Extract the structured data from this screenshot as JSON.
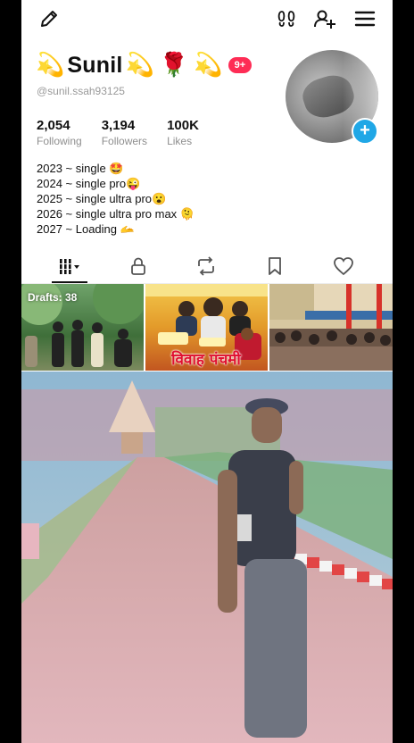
{
  "profile": {
    "name": "Sunil",
    "name_emoji_left": "💫",
    "name_emoji_mid1": "💫",
    "name_emoji_rose": "🌹",
    "name_emoji_mid2": "💫",
    "notification_badge": "9+",
    "handle": "@sunil.ssah93125"
  },
  "stats": [
    {
      "value": "2,054",
      "label": "Following"
    },
    {
      "value": "3,194",
      "label": "Followers"
    },
    {
      "value": "100K",
      "label": "Likes"
    }
  ],
  "bio": [
    "2023 ~ single 🤩",
    "2024 ~ single pro😜",
    "2025 ~ single ultra pro😮",
    "2026 ~ single ultra pro max 🫠",
    "2027 ~ Loading 🫴"
  ],
  "tabs": {
    "active": "videos",
    "items": [
      "videos-grid-icon",
      "lock-icon",
      "repost-icon",
      "bookmark-icon",
      "heart-icon"
    ]
  },
  "grid": {
    "drafts_label": "Drafts: 38",
    "thumb2_title": "विवाह पंचमी"
  },
  "colors": {
    "accent_red": "#fe2c55",
    "avatar_plus_blue": "#20a7e6"
  }
}
